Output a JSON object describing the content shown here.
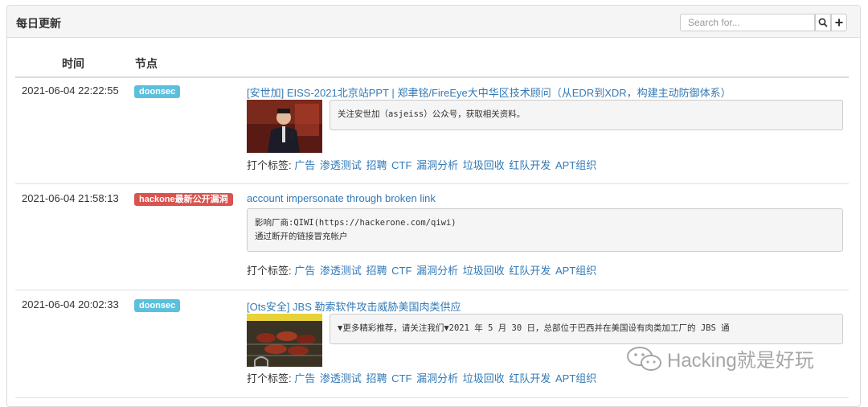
{
  "header": {
    "title": "每日更新",
    "search_placeholder": "Search for...",
    "search_icon": "search-icon",
    "add_icon": "plus-icon"
  },
  "table": {
    "columns": [
      "时间",
      "节点"
    ]
  },
  "tag_prefix": "打个标签:",
  "tags": [
    "广告",
    "渗透测试",
    "招聘",
    "CTF",
    "漏洞分析",
    "垃圾回收",
    "红队开发",
    "APT组织"
  ],
  "rows": [
    {
      "time": "2021-06-04 22:22:55",
      "badge": "doonsec",
      "badge_color": "#5bc0de",
      "title": "[安世加] EISS-2021北京站PPT | 郑聿铭/FireEye大中华区技术顾问（从EDR到XDR，构建主动防御体系）",
      "excerpt": [
        "关注安世加（asjeiss）公众号，获取相关资料。"
      ]
    },
    {
      "time": "2021-06-04 21:58:13",
      "badge": "hackone最新公开漏洞",
      "badge_color": "#d9534f",
      "title": "account impersonate through broken link",
      "excerpt": [
        "影响厂商:QIWI(https://hackerone.com/qiwi)",
        "通过断开的链接冒充帐户"
      ]
    },
    {
      "time": "2021-06-04 20:02:33",
      "badge": "doonsec",
      "badge_color": "#5bc0de",
      "title": "[Ots安全] JBS 勒索软件攻击威胁美国肉类供应",
      "excerpt": [
        "▼更多精彩推荐，请关注我们▼2021 年 5 月 30 日，总部位于巴西并在美国设有肉类加工厂的 JBS 通"
      ]
    }
  ],
  "watermark": "Hacking就是好玩"
}
